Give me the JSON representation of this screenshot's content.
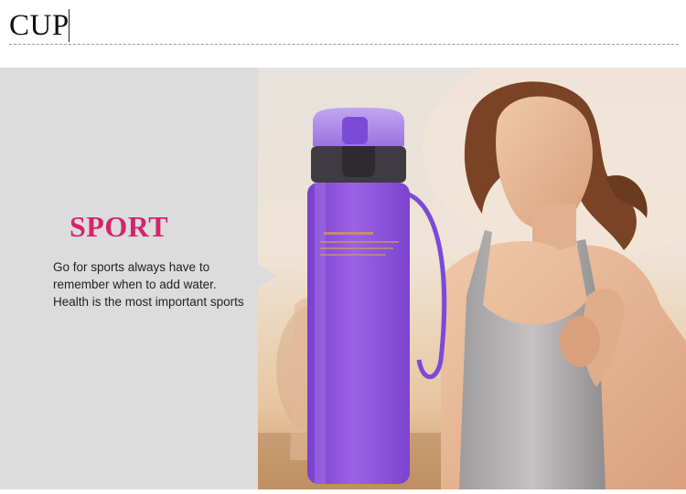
{
  "header": {
    "title": "CUP"
  },
  "feature": {
    "title": "SPORT",
    "description": "Go for sports always have to remember when to add water. Health is the most important sports"
  },
  "photo": {
    "subject": "woman-running-with-water-bottle",
    "bottle_color": "#8a52d8",
    "accent_color": "#d6246b"
  }
}
